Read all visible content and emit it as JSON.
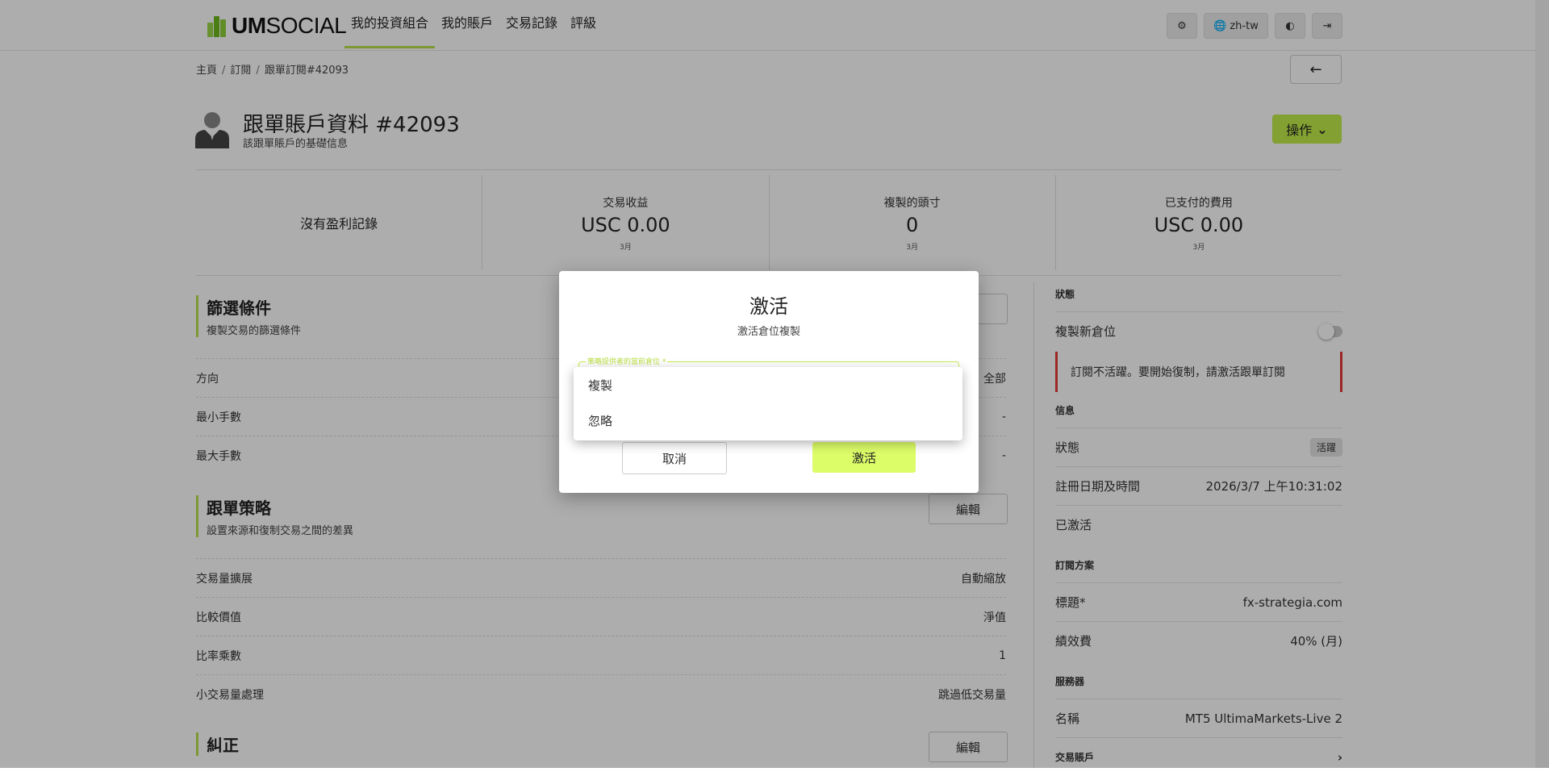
{
  "header": {
    "logo_bold": "UM",
    "logo_rest": "SOCIAL",
    "nav": [
      "我的投資組合",
      "我的賬戶",
      "交易記錄",
      "評級"
    ],
    "lang": "zh-tw"
  },
  "breadcrumb": [
    "主頁",
    "訂閱",
    "跟單訂閱#42093"
  ],
  "profile": {
    "title": "跟單賬戶資料 #42093",
    "subtitle": "該跟單賬戶的基礎信息",
    "action_label": "操作"
  },
  "stats": {
    "no_profit": "沒有盈利記錄",
    "items": [
      {
        "label": "交易收益",
        "value": "USC 0.00",
        "sub": "3月"
      },
      {
        "label": "複製的頭寸",
        "value": "0",
        "sub": "3月"
      },
      {
        "label": "已支付的費用",
        "value": "USC 0.00",
        "sub": "3月"
      }
    ]
  },
  "filter": {
    "title": "篩選條件",
    "subtitle": "複製交易的篩選條件",
    "rows": [
      {
        "label": "方向",
        "value": "全部"
      },
      {
        "label": "最小手數",
        "value": "-"
      },
      {
        "label": "最大手數",
        "value": "-"
      }
    ]
  },
  "strategy": {
    "title": "跟單策略",
    "subtitle": "設置來源和復制交易之間的差異",
    "edit": "編輯",
    "rows": [
      {
        "label": "交易量擴展",
        "value": "自動縮放"
      },
      {
        "label": "比較價值",
        "value": "淨值"
      },
      {
        "label": "比率乘數",
        "value": "1"
      },
      {
        "label": "小交易量處理",
        "value": "跳過低交易量"
      }
    ]
  },
  "correction": {
    "title": "糾正",
    "edit": "編輯"
  },
  "right": {
    "status_head": "狀態",
    "copy_new": "複製新倉位",
    "alert": "訂閱不活躍。要開始復制，請激活跟單訂閱",
    "info_head": "信息",
    "status_label": "狀態",
    "status_badge": "活躍",
    "reg_label": "註冊日期及時間",
    "reg_value": "2026/3/7 上午10:31:02",
    "activated": "已激活",
    "plan_head": "訂閱方案",
    "plan_title_label": "標題*",
    "plan_title_value": "fx-strategia.com",
    "fee_label": "績效費",
    "fee_value": "40% (月)",
    "server_head": "服務器",
    "server_name_label": "名稱",
    "server_name_value": "MT5 UltimaMarkets-Live 2",
    "trade_account_head": "交易賬戶"
  },
  "modal": {
    "title": "激活",
    "subtitle": "激活倉位複製",
    "select_label": "策略提供者的當前倉位 *",
    "options": [
      "複製",
      "忽略"
    ],
    "cancel": "取消",
    "confirm": "激活"
  }
}
